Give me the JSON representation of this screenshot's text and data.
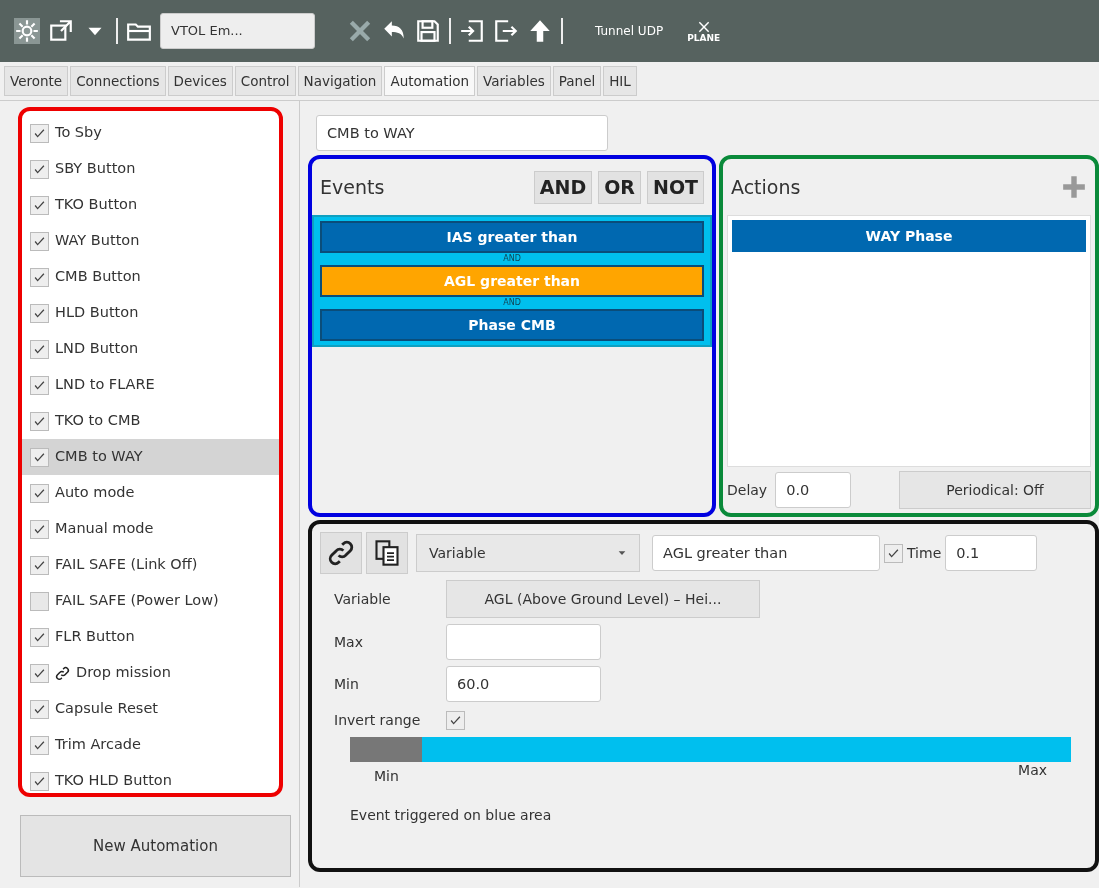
{
  "toolbar": {
    "project": "VTOL Em...",
    "connection": "Tunnel UDP",
    "plane_label": "PLANE"
  },
  "tabs": [
    {
      "label": "Veronte",
      "selected": false
    },
    {
      "label": "Connections",
      "selected": false
    },
    {
      "label": "Devices",
      "selected": false
    },
    {
      "label": "Control",
      "selected": false
    },
    {
      "label": "Navigation",
      "selected": false
    },
    {
      "label": "Automation",
      "selected": true
    },
    {
      "label": "Variables",
      "selected": false
    },
    {
      "label": "Panel",
      "selected": false
    },
    {
      "label": "HIL",
      "selected": false
    }
  ],
  "automations": [
    {
      "label": "To Sby",
      "checked": true,
      "selected": false,
      "linked": false
    },
    {
      "label": "SBY Button",
      "checked": true,
      "selected": false,
      "linked": false
    },
    {
      "label": "TKO Button",
      "checked": true,
      "selected": false,
      "linked": false
    },
    {
      "label": "WAY Button",
      "checked": true,
      "selected": false,
      "linked": false
    },
    {
      "label": "CMB Button",
      "checked": true,
      "selected": false,
      "linked": false
    },
    {
      "label": "HLD Button",
      "checked": true,
      "selected": false,
      "linked": false
    },
    {
      "label": "LND Button",
      "checked": true,
      "selected": false,
      "linked": false
    },
    {
      "label": "LND to FLARE",
      "checked": true,
      "selected": false,
      "linked": false
    },
    {
      "label": "TKO to CMB",
      "checked": true,
      "selected": false,
      "linked": false
    },
    {
      "label": "CMB to WAY",
      "checked": true,
      "selected": true,
      "linked": false
    },
    {
      "label": "Auto mode",
      "checked": true,
      "selected": false,
      "linked": false
    },
    {
      "label": "Manual mode",
      "checked": true,
      "selected": false,
      "linked": false
    },
    {
      "label": "FAIL SAFE (Link Off)",
      "checked": true,
      "selected": false,
      "linked": false
    },
    {
      "label": "FAIL SAFE (Power Low)",
      "checked": false,
      "selected": false,
      "linked": false
    },
    {
      "label": "FLR Button",
      "checked": true,
      "selected": false,
      "linked": false
    },
    {
      "label": "Drop mission",
      "checked": true,
      "selected": false,
      "linked": true
    },
    {
      "label": "Capsule Reset",
      "checked": true,
      "selected": false,
      "linked": false
    },
    {
      "label": "Trim Arcade",
      "checked": true,
      "selected": false,
      "linked": false
    },
    {
      "label": "TKO HLD Button",
      "checked": true,
      "selected": false,
      "linked": false
    }
  ],
  "new_automation_button": "New Automation",
  "automation_name": "CMB to WAY",
  "events": {
    "title": "Events",
    "operators": [
      "AND",
      "OR",
      "NOT"
    ],
    "items": [
      {
        "kind": "condition",
        "label": "IAS greater than",
        "selected": false
      },
      {
        "kind": "operator",
        "label": "AND"
      },
      {
        "kind": "condition",
        "label": "AGL greater than",
        "selected": true
      },
      {
        "kind": "operator",
        "label": "AND"
      },
      {
        "kind": "condition",
        "label": "Phase CMB",
        "selected": false
      }
    ]
  },
  "actions": {
    "title": "Actions",
    "items": [
      {
        "label": "WAY Phase",
        "selected": true
      }
    ],
    "delay_label": "Delay",
    "delay": "0.0",
    "periodical_button": "Periodical: Off"
  },
  "event_editor": {
    "type": "Variable",
    "name": "AGL greater than",
    "time_checked": true,
    "time_label": "Time",
    "time": "0.1",
    "variable_label": "Variable",
    "variable": "AGL (Above Ground Level) – Hei...",
    "max_label": "Max",
    "min_label": "Min",
    "min": "60.0",
    "invert_label": "Invert range",
    "invert_checked": true,
    "range_bar": {
      "level": 0.9,
      "min_label": "Min",
      "max_label": "Max"
    },
    "note": "Event triggered on blue area"
  }
}
